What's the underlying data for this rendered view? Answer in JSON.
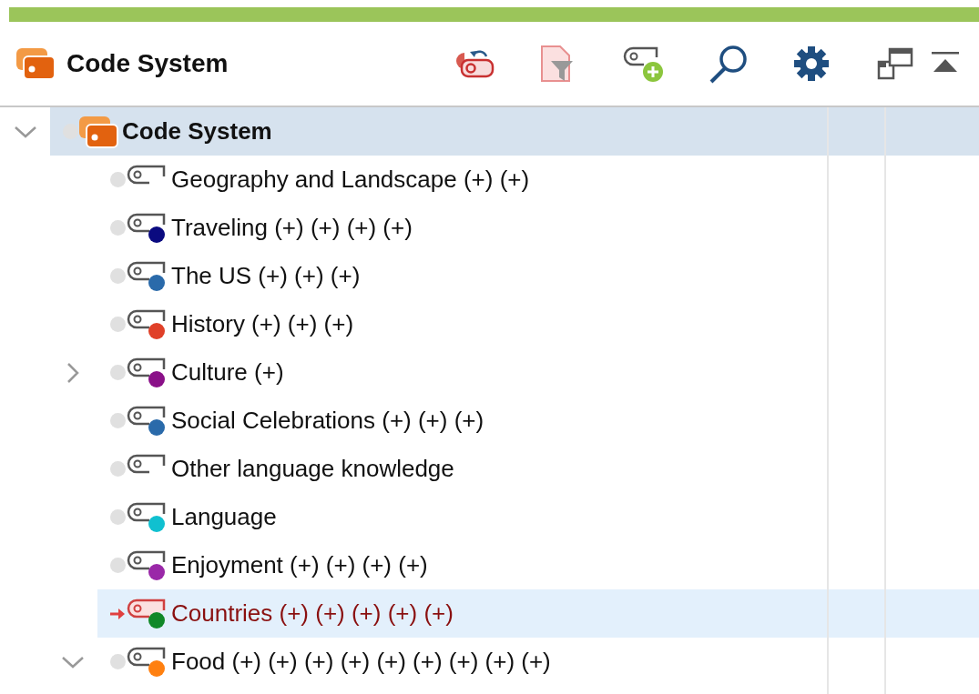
{
  "panel": {
    "title": "Code System"
  },
  "tree": {
    "label": "Code System",
    "expanded": true,
    "selected": true,
    "activated": false,
    "children": [
      {
        "label": "Geography and Landscape (+) (+)",
        "selected": false,
        "activated": false
      },
      {
        "label": "Traveling (+) (+) (+) (+)",
        "selected": false,
        "activated": false,
        "color": "#0a0a80"
      },
      {
        "label": "The US (+) (+) (+)",
        "selected": false,
        "activated": false,
        "color": "#2a6aaa"
      },
      {
        "label": "History (+) (+) (+)",
        "selected": false,
        "activated": false,
        "color": "#e04028"
      },
      {
        "label": "Culture (+)",
        "expanded": false,
        "selected": false,
        "activated": false,
        "color": "#8a1088"
      },
      {
        "label": "Social Celebrations (+) (+) (+)",
        "selected": false,
        "activated": false,
        "color": "#2a6aaa"
      },
      {
        "label": "Other language knowledge",
        "selected": false,
        "activated": false
      },
      {
        "label": "Language",
        "selected": false,
        "activated": false,
        "color": "#10c0d0"
      },
      {
        "label": "Enjoyment (+) (+) (+) (+)",
        "selected": false,
        "activated": false,
        "color": "#9a28a8"
      },
      {
        "label": "Countries (+) (+) (+) (+) (+)",
        "selected": false,
        "activated": true,
        "color": "#108828"
      },
      {
        "label": "Food (+) (+) (+) (+) (+) (+) (+) (+) (+)",
        "expanded": true,
        "selected": false,
        "activated": false,
        "color": "#ff8010"
      }
    ]
  }
}
